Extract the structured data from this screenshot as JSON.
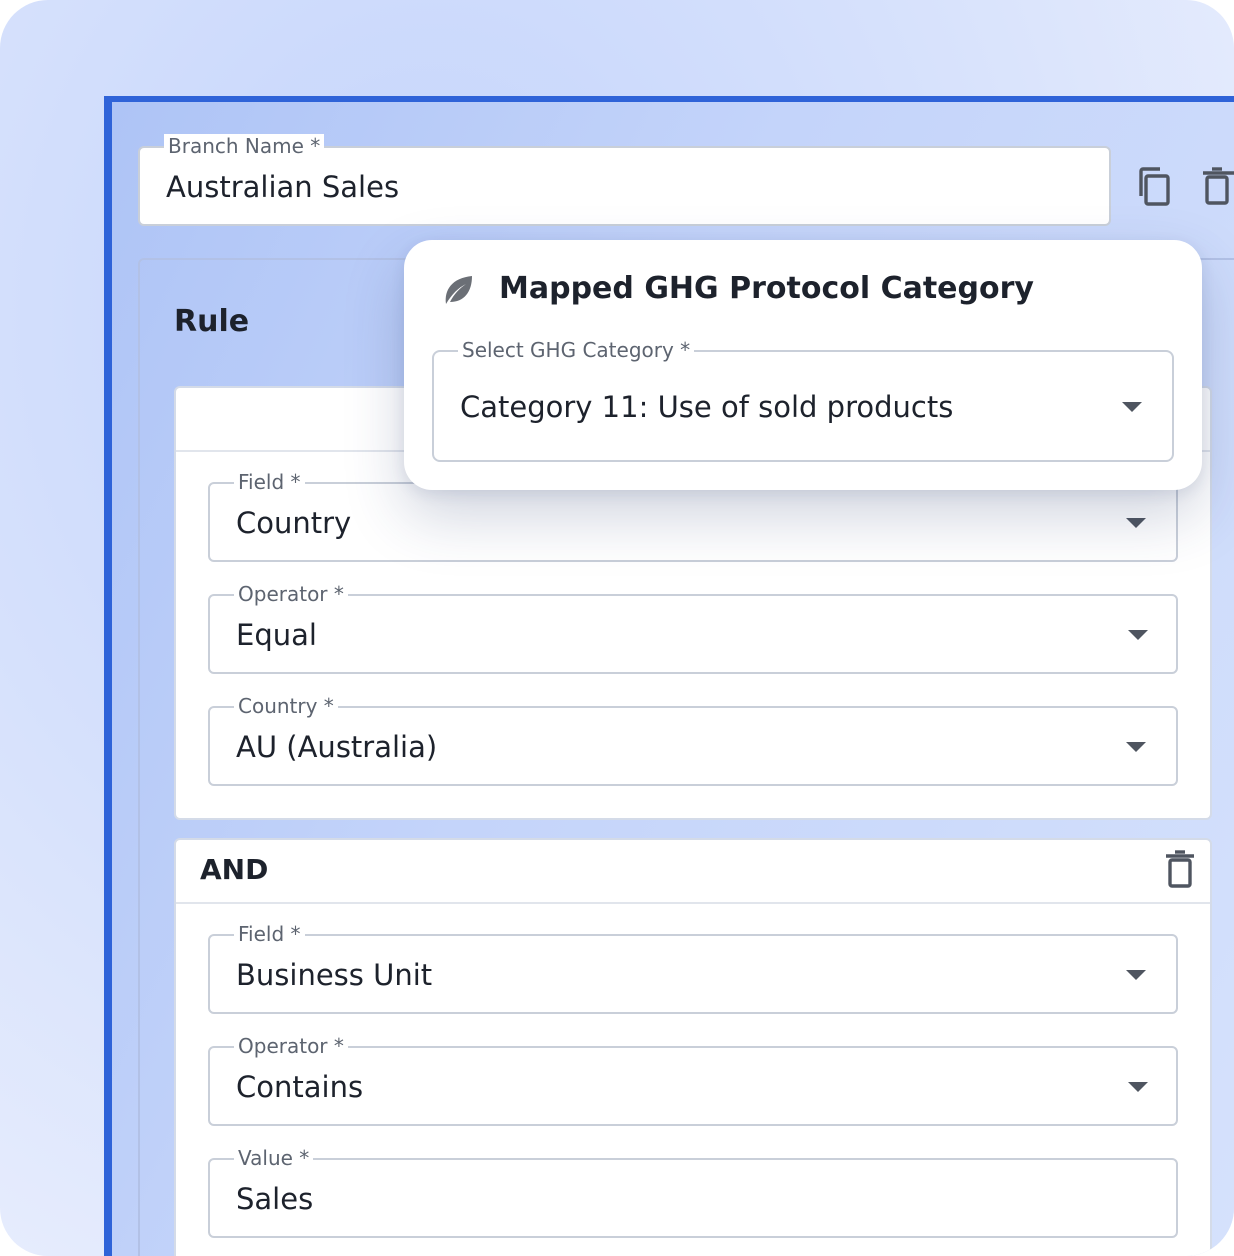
{
  "branch": {
    "name_label": "Branch Name *",
    "name_value": "Australian Sales"
  },
  "rule": {
    "title": "Rule",
    "conditions": [
      {
        "field": {
          "label": "Field *",
          "value": "Country"
        },
        "operator": {
          "label": "Operator *",
          "value": "Equal"
        },
        "value": {
          "label": "Country *",
          "value": "AU (Australia)"
        }
      },
      {
        "connector": "AND",
        "field": {
          "label": "Field *",
          "value": "Business Unit"
        },
        "operator": {
          "label": "Operator *",
          "value": "Contains"
        },
        "value": {
          "label": "Value *",
          "value": "Sales"
        }
      }
    ]
  },
  "ghg_popup": {
    "icon": "leaf-icon",
    "title": "Mapped GHG Protocol Category",
    "select_label": "Select GHG Category *",
    "select_value": "Category 11: Use of sold products"
  },
  "icons": {
    "copy": "copy-icon",
    "delete": "trash-icon",
    "dropdown": "chevron-down-icon"
  },
  "colors": {
    "accent": "#2f63d8",
    "leaf": "#6b6f76"
  }
}
